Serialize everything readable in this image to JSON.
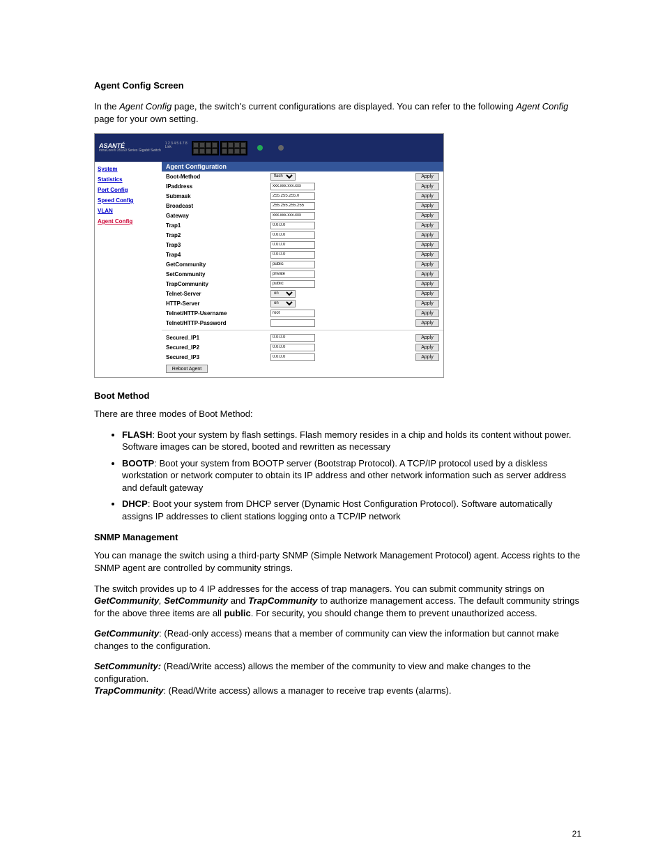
{
  "page_number": "21",
  "heading1": "Agent Config Screen",
  "intro_prefix": "In the ",
  "intro_italic1": "Agent Config",
  "intro_mid": " page, the switch's current configurations are displayed. You can refer to the following ",
  "intro_italic2": "Agent Config",
  "intro_suffix": " page for your own setting.",
  "shot": {
    "brand": "ASANTÉ",
    "nav": [
      "System",
      "Statistics",
      "Port Config",
      "Speed Config",
      "VLAN",
      "Agent Config"
    ],
    "panel_title": "Agent Configuration",
    "rows": [
      {
        "label": "Boot-Method",
        "type": "select",
        "value": "flash",
        "apply": "Apply"
      },
      {
        "label": "IPaddress",
        "type": "input",
        "value": "xxx.xxx.xxx.xxx",
        "apply": "Apply"
      },
      {
        "label": "Submask",
        "type": "input",
        "value": "255.255.255.0",
        "apply": "Apply"
      },
      {
        "label": "Broadcast",
        "type": "input",
        "value": "255.255.255.255",
        "apply": "Apply"
      },
      {
        "label": "Gateway",
        "type": "input",
        "value": "xxx.xxx.xxx.xxx",
        "apply": "Apply"
      },
      {
        "label": "Trap1",
        "type": "input",
        "value": "0.0.0.0",
        "apply": "Apply"
      },
      {
        "label": "Trap2",
        "type": "input",
        "value": "0.0.0.0",
        "apply": "Apply"
      },
      {
        "label": "Trap3",
        "type": "input",
        "value": "0.0.0.0",
        "apply": "Apply"
      },
      {
        "label": "Trap4",
        "type": "input",
        "value": "0.0.0.0",
        "apply": "Apply"
      },
      {
        "label": "GetCommunity",
        "type": "input",
        "value": "public",
        "apply": "Apply"
      },
      {
        "label": "SetCommunity",
        "type": "input",
        "value": "private",
        "apply": "Apply"
      },
      {
        "label": "TrapCommunity",
        "type": "input",
        "value": "public",
        "apply": "Apply"
      },
      {
        "label": "Telnet-Server",
        "type": "select",
        "value": "on",
        "apply": "Apply"
      },
      {
        "label": "HTTP-Server",
        "type": "select",
        "value": "on",
        "apply": "Apply"
      },
      {
        "label": "Telnet/HTTP-Username",
        "type": "input",
        "value": "root",
        "apply": "Apply"
      },
      {
        "label": "Telnet/HTTP-Password",
        "type": "input",
        "value": "",
        "apply": "Apply"
      }
    ],
    "rows2": [
      {
        "label": "Secured_IP1",
        "type": "input",
        "value": "0.0.0.0",
        "apply": "Apply"
      },
      {
        "label": "Secured_IP2",
        "type": "input",
        "value": "0.0.0.0",
        "apply": "Apply"
      },
      {
        "label": "Secured_IP3",
        "type": "input",
        "value": "0.0.0.0",
        "apply": "Apply"
      }
    ],
    "reboot": "Reboot Agent"
  },
  "bm_heading": "Boot Method",
  "bm_intro": "There are three modes of Boot Method:",
  "bm": {
    "flash_t": "FLASH",
    "flash_d": ": Boot your system by flash settings. Flash memory resides in a chip and holds its content without power. Software images can be stored, booted and rewritten as necessary",
    "bootp_t": "BOOTP",
    "bootp_d": ": Boot your system from BOOTP server (Bootstrap Protocol). A TCP/IP protocol used by a diskless workstation or network computer to obtain its IP address and other network information such as server address and default gateway",
    "dhcp_t": "DHCP",
    "dhcp_d": ": Boot your system from DHCP server (Dynamic Host Configuration Protocol). Software automatically assigns IP addresses to client stations logging onto a TCP/IP network"
  },
  "snmp_heading": "SNMP Management",
  "snmp_p1": "You can manage the switch using a third-party SNMP (Simple Network Management Protocol) agent. Access rights to the SNMP agent are controlled by community strings.",
  "snmp_p2_a": "The switch provides up to 4 IP addresses for the access of trap managers. You can submit community strings on ",
  "snmp_p2_gc": "GetCommunity",
  "snmp_p2_b": ", ",
  "snmp_p2_sc": "SetCommunity",
  "snmp_p2_c": " and ",
  "snmp_p2_tc": "TrapCommunity",
  "snmp_p2_d": " to authorize management access. The default community strings for the above three items are all ",
  "snmp_p2_pub": "public",
  "snmp_p2_e": ". For security, you should change them to prevent unauthorized access.",
  "get_t": "GetCommunity",
  "get_d": ": (Read-only access) means that a member of community can view the information but cannot make changes to the configuration.",
  "set_t": "SetCommunity:",
  "set_d": " (Read/Write access) allows the member of the community to view and make changes to the configuration.",
  "trap_t": "TrapCommunity",
  "trap_d": ": (Read/Write access) allows a manager to receive trap events (alarms)."
}
